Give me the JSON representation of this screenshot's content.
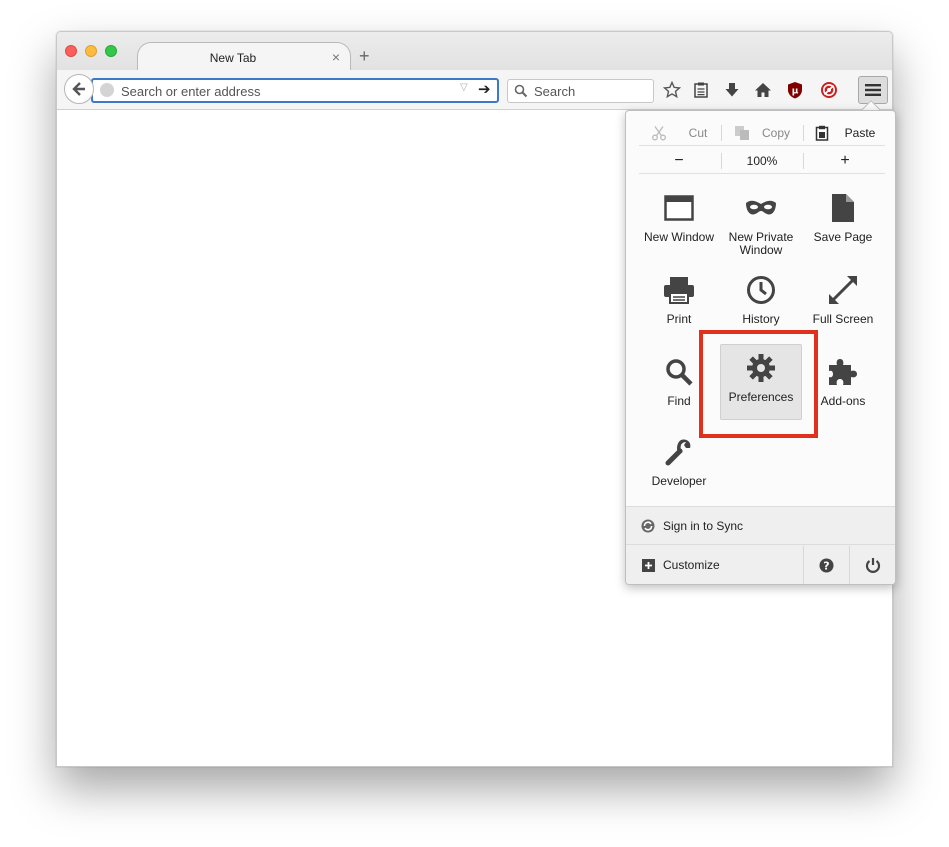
{
  "tab": {
    "title": "New Tab",
    "close": "×",
    "new": "+"
  },
  "navbar": {
    "url_placeholder": "Search or enter address",
    "search_placeholder": "Search",
    "go": "➔",
    "dropdown": "▽"
  },
  "panel": {
    "edit": {
      "cut": "Cut",
      "copy": "Copy",
      "paste": "Paste"
    },
    "zoom": {
      "minus": "−",
      "level": "100%",
      "plus": "+"
    },
    "items": {
      "new_window": "New Window",
      "new_private_1": "New Private",
      "new_private_2": "Window",
      "save_page": "Save Page",
      "print": "Print",
      "history": "History",
      "full_screen": "Full Screen",
      "find": "Find",
      "preferences": "Preferences",
      "addons": "Add-ons",
      "developer": "Developer"
    },
    "sync": "Sign in to Sync",
    "customize": "Customize"
  },
  "colors": {
    "highlight": "#e0301e",
    "urlbar_focus": "#3e78c8",
    "icon": "#4a4a4a"
  }
}
